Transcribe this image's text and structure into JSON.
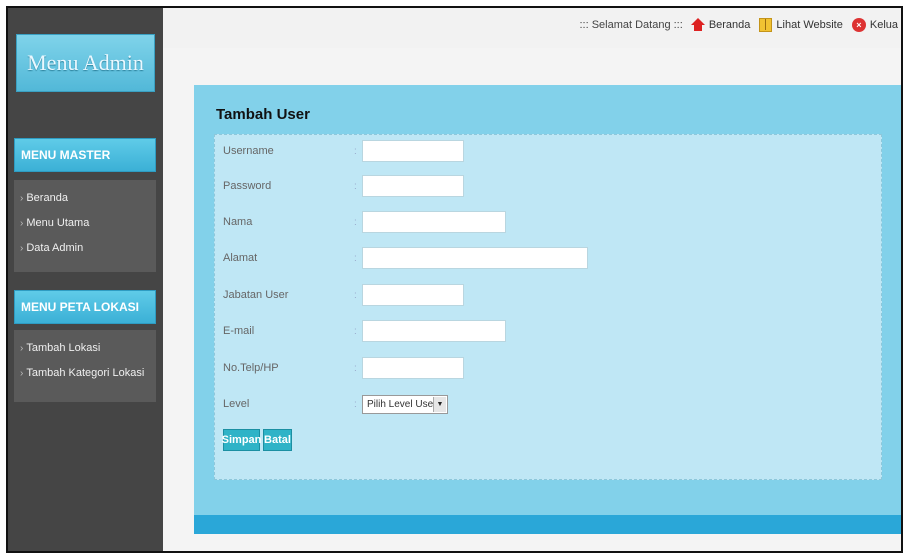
{
  "sidebar": {
    "logo_text": "Menu Admin",
    "sections": [
      {
        "title": "MENU MASTER",
        "items": [
          "Beranda",
          "Menu Utama",
          "Data Admin"
        ]
      },
      {
        "title": "MENU PETA LOKASI",
        "items": [
          "Tambah Lokasi",
          "Tambah Kategori Lokasi"
        ]
      }
    ]
  },
  "topbar": {
    "welcome": "::: Selamat Datang :::",
    "links": [
      {
        "label": "Beranda",
        "icon": "home-icon"
      },
      {
        "label": "Lihat Website",
        "icon": "book-icon"
      },
      {
        "label": "Kelua",
        "icon": "exit-icon"
      }
    ]
  },
  "form": {
    "title": "Tambah User",
    "separator": ":",
    "fields": [
      {
        "label": "Username",
        "value": ""
      },
      {
        "label": "Password",
        "value": ""
      },
      {
        "label": "Nama",
        "value": ""
      },
      {
        "label": "Alamat",
        "value": ""
      },
      {
        "label": "Jabatan User",
        "value": ""
      },
      {
        "label": "E-mail",
        "value": ""
      },
      {
        "label": "No.Telp/HP",
        "value": ""
      }
    ],
    "level": {
      "label": "Level",
      "selected": "Pilih Level User"
    },
    "buttons": {
      "save": "Simpan",
      "cancel": "Batal"
    }
  },
  "colors": {
    "accent": "#2fb3c7",
    "panel": "#82d1ea",
    "sidebar": "#454545"
  }
}
